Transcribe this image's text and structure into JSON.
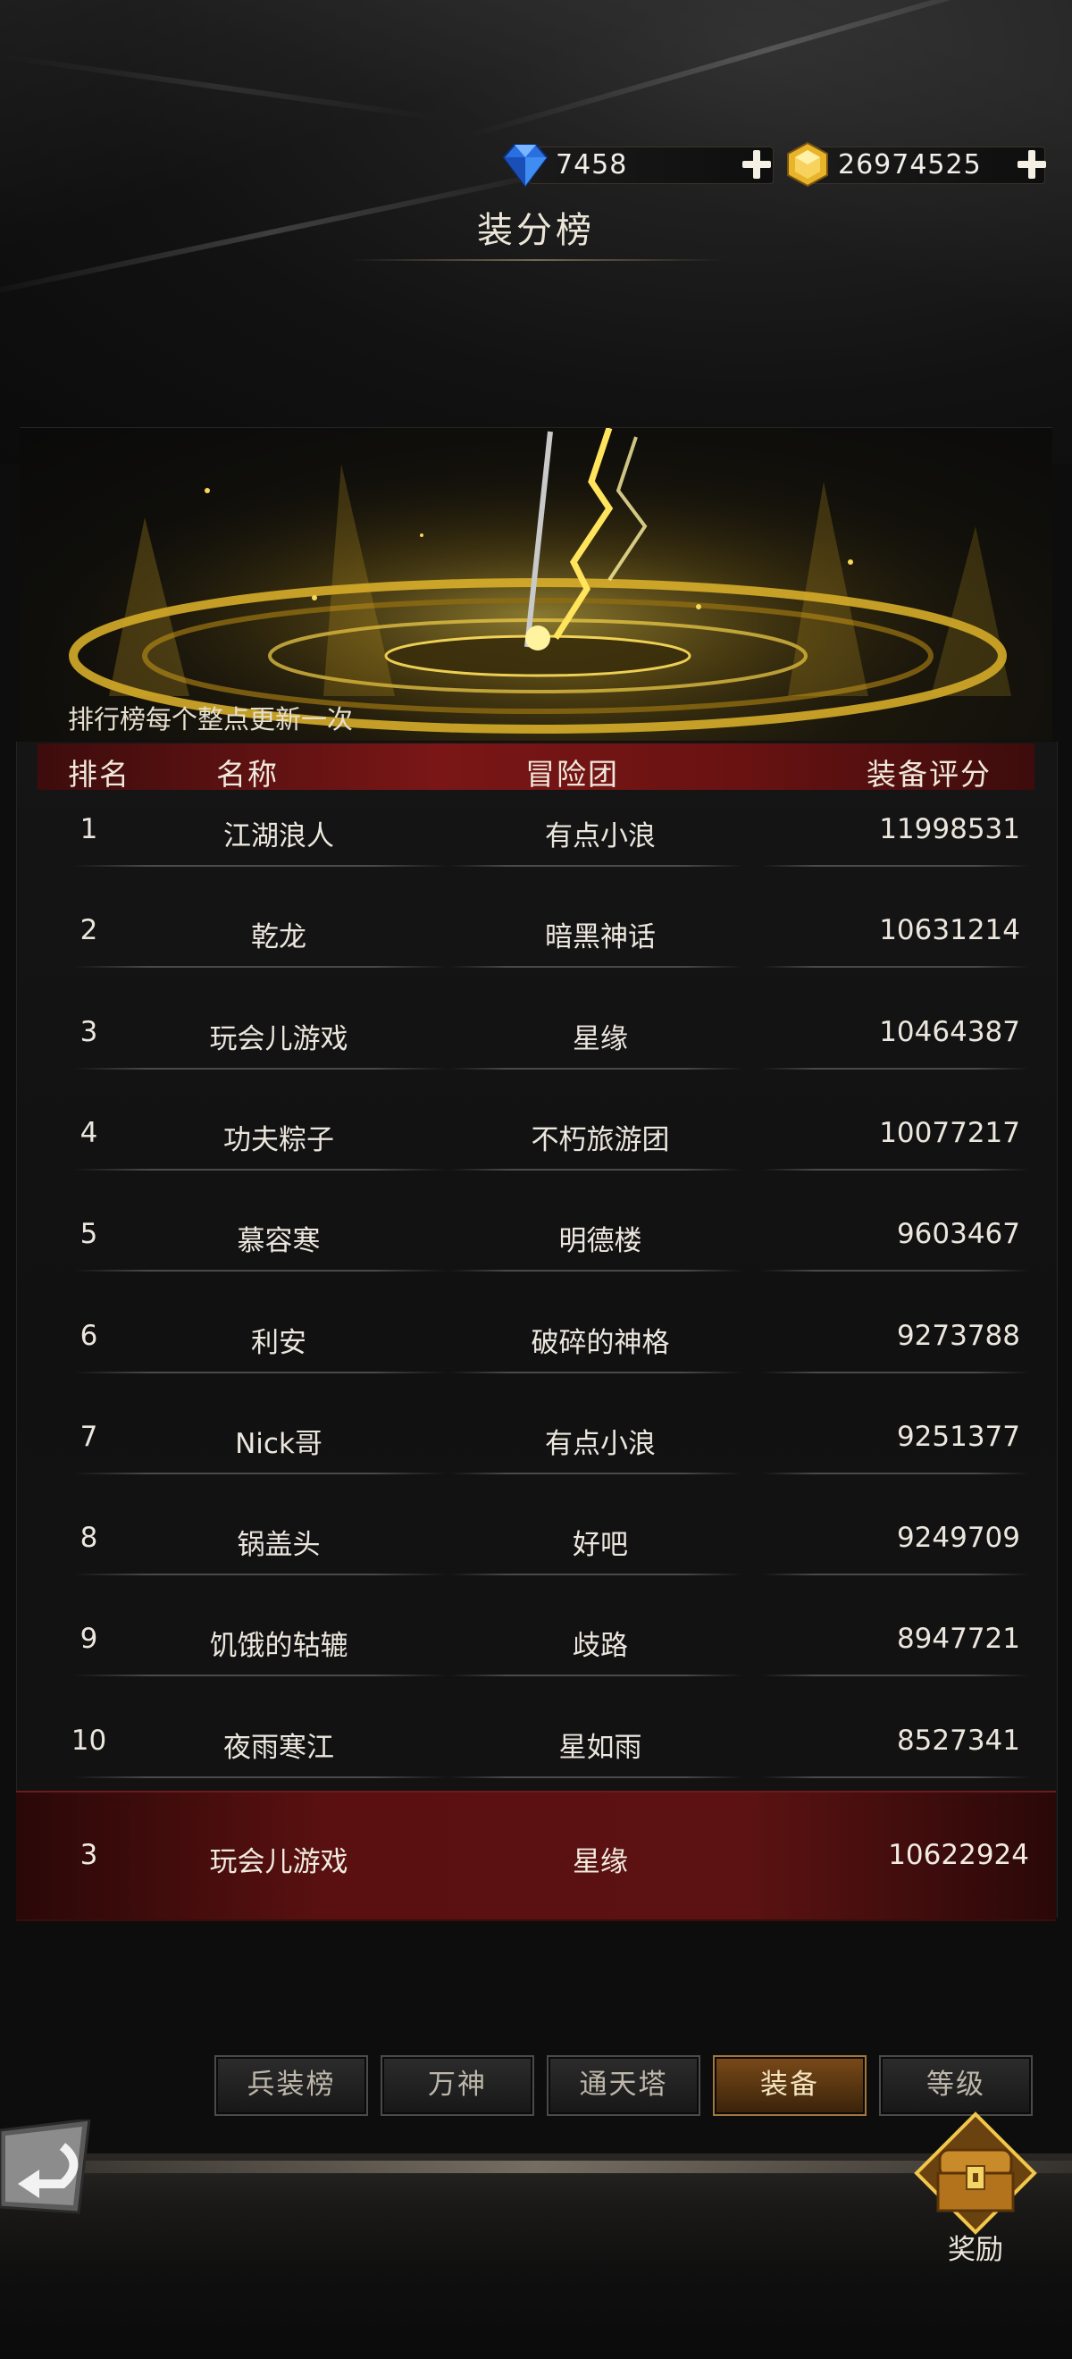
{
  "currency": {
    "diamonds": "7458",
    "gold": "26974525"
  },
  "page_title": "装分榜",
  "update_note": "排行榜每个整点更新一次",
  "table": {
    "headers": {
      "rank": "排名",
      "name": "名称",
      "guild": "冒险团",
      "score": "装备评分"
    },
    "rows": [
      {
        "rank": "1",
        "name": "江湖浪人",
        "guild": "有点小浪",
        "score": "11998531"
      },
      {
        "rank": "2",
        "name": "乾龙",
        "guild": "暗黑神话",
        "score": "10631214"
      },
      {
        "rank": "3",
        "name": "玩会儿游戏",
        "guild": "星缘",
        "score": "10464387"
      },
      {
        "rank": "4",
        "name": "功夫粽子",
        "guild": "不朽旅游团",
        "score": "10077217"
      },
      {
        "rank": "5",
        "name": "慕容寒",
        "guild": "明德楼",
        "score": "9603467"
      },
      {
        "rank": "6",
        "name": "利安",
        "guild": "破碎的神格",
        "score": "9273788"
      },
      {
        "rank": "7",
        "name": "Nick哥",
        "guild": "有点小浪",
        "score": "9251377"
      },
      {
        "rank": "8",
        "name": "锅盖头",
        "guild": "好吧",
        "score": "9249709"
      },
      {
        "rank": "9",
        "name": "饥饿的轱辘",
        "guild": "歧路",
        "score": "8947721"
      },
      {
        "rank": "10",
        "name": "夜雨寒江",
        "guild": "星如雨",
        "score": "8527341"
      }
    ],
    "my_row": {
      "rank": "3",
      "name": "玩会儿游戏",
      "guild": "星缘",
      "score": "10622924"
    }
  },
  "tabs": [
    {
      "label": "兵装榜",
      "active": false
    },
    {
      "label": "万神",
      "active": false
    },
    {
      "label": "通天塔",
      "active": false
    },
    {
      "label": "装备",
      "active": true
    },
    {
      "label": "等级",
      "active": false
    }
  ],
  "reward_label": "奖励",
  "icons": {
    "diamond": "blue-diamond-icon",
    "gold": "gold-coin-icon",
    "plus": "plus-icon",
    "back": "back-arrow-icon",
    "reward": "treasure-chest-icon"
  },
  "colors": {
    "header_red": "#7a1616",
    "active_tab": "#7a4a18",
    "highlight_row": "#5a1010",
    "banner_glow": "#f5d23a"
  }
}
